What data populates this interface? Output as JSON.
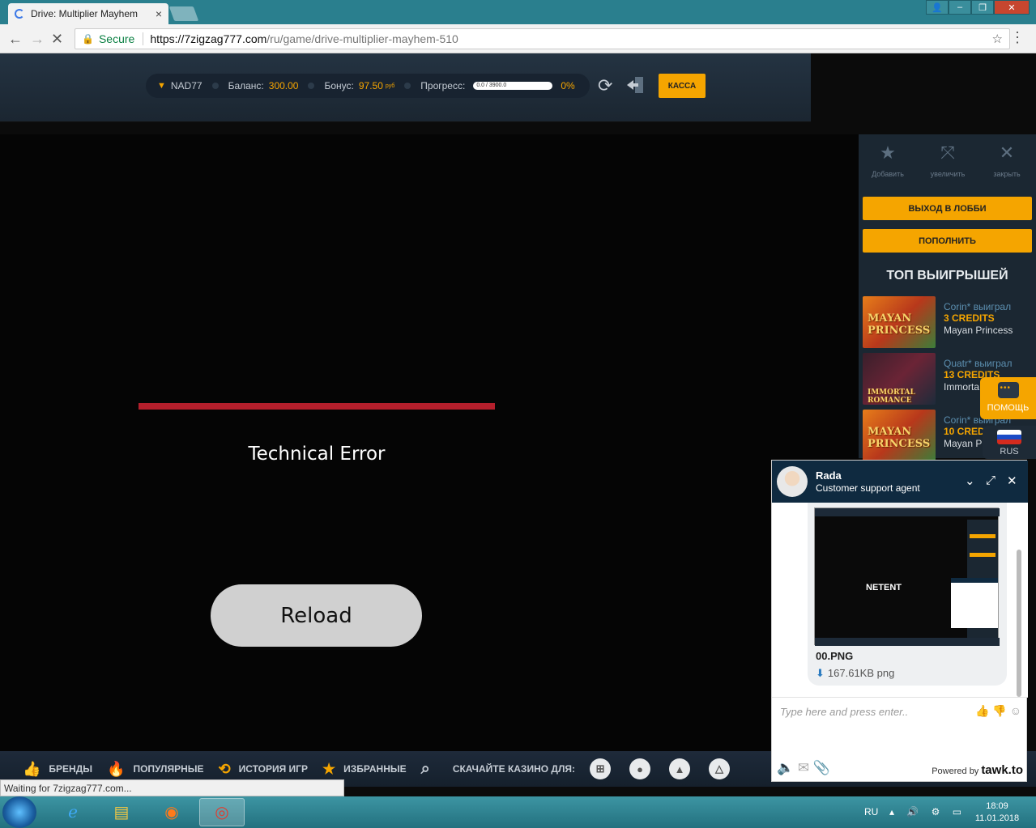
{
  "browser": {
    "tab_title": "Drive: Multiplier Mayhem",
    "tab_close": "×",
    "secure_label": "Secure",
    "url_host": "https://7zigzag777.com",
    "url_path": "/ru/game/drive-multiplier-mayhem-510",
    "status_text": "Waiting for 7zigzag777.com..."
  },
  "header": {
    "username": "NAD77",
    "balance_label": "Баланс:",
    "balance_value": "300.00",
    "bonus_label": "Бонус:",
    "bonus_value": "97.50",
    "bonus_currency": "руб",
    "progress_label": "Прогресс:",
    "progress_text": "0.0 / 3900.0",
    "progress_fraction": 0,
    "progress_percent": "0%",
    "kassa_label": "КАССА"
  },
  "game": {
    "error_text": "Technical Error",
    "reload_label": "Reload"
  },
  "right_panel": {
    "tools": [
      {
        "label": "Добавить",
        "icon": "star-icon"
      },
      {
        "label": "увеличить",
        "icon": "expand-icon"
      },
      {
        "label": "закрыть",
        "icon": "close-icon"
      }
    ],
    "lobby_label": "ВЫХОД В ЛОББИ",
    "deposit_label": "ПОПОЛНИТЬ",
    "top_title": "ТОП ВЫИГРЫШЕЙ",
    "winners": [
      {
        "who": "Corin* выиграл",
        "amount": "3 CREDITS",
        "game": "Mayan Princess",
        "thumb": "MAYAN PRINCESS"
      },
      {
        "who": "Quatr* выиграл",
        "amount": "13 CREDITS",
        "game": "Immorta",
        "thumb": "IMMORTAL ROMANCE"
      },
      {
        "who": "Corin* выиграл",
        "amount": "10 CRED",
        "game": "Mayan P",
        "thumb": "MAYAN PRINCESS"
      }
    ],
    "help_label": "ПОМОЩЬ",
    "lang_label": "RUS"
  },
  "bottom_nav": {
    "brands": "БРЕНДЫ",
    "popular": "ПОПУЛЯРНЫЕ",
    "history": "ИСТОРИЯ ИГР",
    "favorites": "ИЗБРАННЫЕ",
    "download": "СКАЧАЙТЕ КАЗИНО ДЛЯ:"
  },
  "chat": {
    "agent_name": "Rada",
    "agent_role": "Customer support agent",
    "attachment_name": "00.PNG",
    "attachment_size": "167.61KB png",
    "thumb_caption": "NETENT",
    "input_placeholder": "Type here and press enter..",
    "powered_by": "Powered by",
    "brand": "tawk.to"
  },
  "taskbar": {
    "lang": "RU",
    "time": "18:09",
    "date": "11.01.2018"
  },
  "colors": {
    "accent": "#f5a500",
    "error_red": "#b41f2c",
    "header_bg": "#243342",
    "chat_header": "#0f2a40"
  }
}
